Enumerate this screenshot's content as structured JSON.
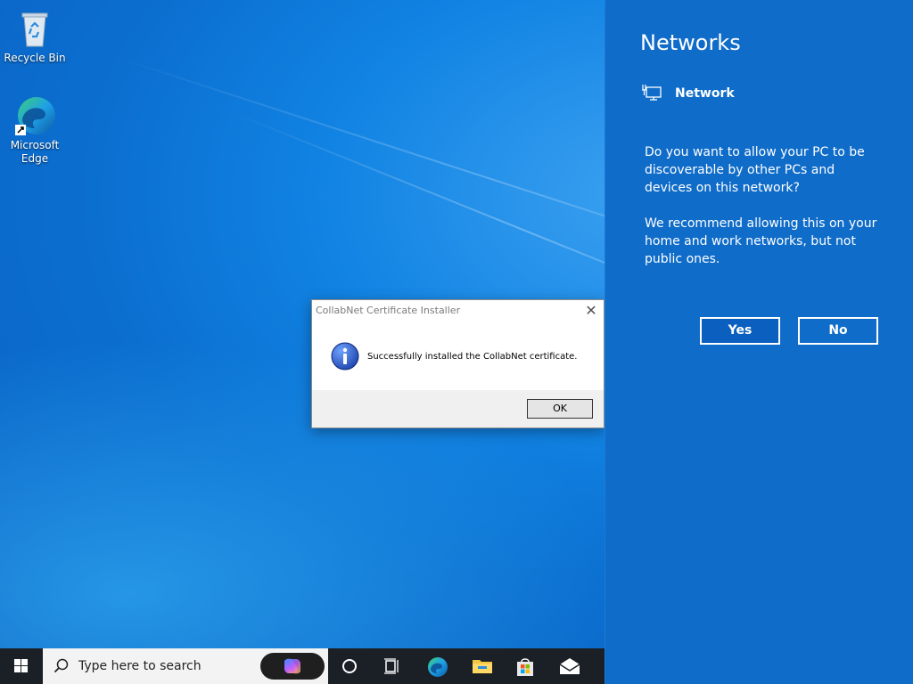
{
  "desktop": {
    "icons": [
      {
        "label": "Recycle Bin",
        "icon": "recycle-bin-icon"
      },
      {
        "label": "Microsoft Edge",
        "icon": "edge-icon"
      }
    ]
  },
  "dialog": {
    "title": "CollabNet Certificate Installer",
    "message": "Successfully installed the CollabNet certificate.",
    "ok_label": "OK",
    "close_glyph": "✕",
    "icon": "info-icon"
  },
  "networks_flyout": {
    "title": "Networks",
    "network_name": "Network",
    "question": "Do you want to allow your PC to be discoverable by other PCs and devices on this network?",
    "recommendation": "We recommend allowing this on your home and work networks, but not public ones.",
    "yes_label": "Yes",
    "no_label": "No",
    "accent_color": "#0f6cc9"
  },
  "taskbar": {
    "search_placeholder": "Type here to search",
    "items": [
      "start-icon",
      "copilot-icon",
      "cortana-icon",
      "task-view-icon",
      "edge-icon",
      "file-explorer-icon",
      "store-icon",
      "mail-icon"
    ]
  }
}
